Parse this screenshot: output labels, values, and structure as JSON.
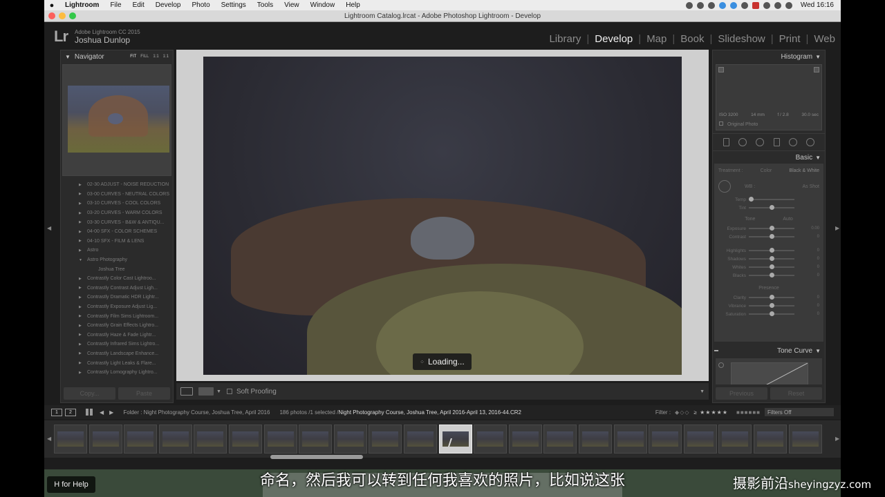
{
  "menubar": {
    "app": "Lightroom",
    "items": [
      "File",
      "Edit",
      "Develop",
      "Photo",
      "Settings",
      "Tools",
      "View",
      "Window",
      "Help"
    ],
    "clock": "Wed 16:16"
  },
  "window": {
    "title": "Lightroom Catalog.lrcat - Adobe Photoshop Lightroom - Develop"
  },
  "identity": {
    "logo": "Lr",
    "product": "Adobe Lightroom CC 2015",
    "user": "Joshua Dunlop"
  },
  "modules": [
    "Library",
    "Develop",
    "Map",
    "Book",
    "Slideshow",
    "Print",
    "Web"
  ],
  "active_module": "Develop",
  "navigator": {
    "title": "Navigator",
    "zoom_options": [
      "FIT",
      "FILL",
      "1:1",
      "1:1"
    ]
  },
  "presets": [
    {
      "label": "02-30 ADJUST - NOISE REDUCTION",
      "type": "folder"
    },
    {
      "label": "03-00 CURVES - NEUTRAL COLORS",
      "type": "folder"
    },
    {
      "label": "03-10 CURVES - COOL COLORS",
      "type": "folder"
    },
    {
      "label": "03-20 CURVES - WARM COLORS",
      "type": "folder"
    },
    {
      "label": "03-30 CURVES - B&W & ANTIQU...",
      "type": "folder"
    },
    {
      "label": "04-00 SFX - COLOR SCHEMES",
      "type": "folder"
    },
    {
      "label": "04-10 SFX - FILM & LENS",
      "type": "folder"
    },
    {
      "label": "Astro",
      "type": "folder"
    },
    {
      "label": "Astro Photography",
      "type": "open"
    },
    {
      "label": "Joshua Tree",
      "type": "child"
    },
    {
      "label": "Contrastly Color Cast Lightroo...",
      "type": "folder"
    },
    {
      "label": "Contrastly Contrast Adjust Ligh...",
      "type": "folder"
    },
    {
      "label": "Contrastly Dramatic HDR Lightr...",
      "type": "folder"
    },
    {
      "label": "Contrastly Exposure Adjust Lig...",
      "type": "folder"
    },
    {
      "label": "Contrastly Film Sims Lightroom...",
      "type": "folder"
    },
    {
      "label": "Contrastly Grain Effects Lightro...",
      "type": "folder"
    },
    {
      "label": "Contrastly Haze & Fade Lightr...",
      "type": "folder"
    },
    {
      "label": "Contrastly Infrared Sims Lightro...",
      "type": "folder"
    },
    {
      "label": "Contrastly Landscape Enhance...",
      "type": "folder"
    },
    {
      "label": "Contrastly Light Leaks & Flare...",
      "type": "folder"
    },
    {
      "label": "Contrastly Lomography Lightro...",
      "type": "folder"
    }
  ],
  "left_buttons": {
    "copy": "Copy...",
    "paste": "Paste"
  },
  "loading": "Loading...",
  "toolbar": {
    "soft_proofing": "Soft Proofing"
  },
  "histogram": {
    "title": "Histogram",
    "iso": "ISO 3200",
    "focal": "14 mm",
    "aperture": "f / 2.8",
    "shutter": "30.0 sec",
    "original_photo": "Original Photo"
  },
  "basic": {
    "title": "Basic",
    "treatment": "Treatment :",
    "color": "Color",
    "bw": "Black & White",
    "wb": "WB :",
    "wb_value": "As Shot",
    "temp": "Temp",
    "tint": "Tint",
    "tone": "Tone",
    "auto": "Auto",
    "exposure": "Exposure",
    "contrast": "Contrast",
    "highlights": "Highlights",
    "shadows": "Shadows",
    "whites": "Whites",
    "blacks": "Blacks",
    "presence": "Presence",
    "clarity": "Clarity",
    "vibrance": "Vibrance",
    "saturation": "Saturation",
    "exposure_val": "0.00",
    "zero": "0"
  },
  "tone_curve": {
    "title": "Tone Curve"
  },
  "right_buttons": {
    "previous": "Previous",
    "reset": "Reset"
  },
  "filmstrip_bar": {
    "view1": "1",
    "view2": "2",
    "folder": "Folder : Night Photography Course, Joshua Tree, April 2016",
    "count": "186 photos /1 selected /",
    "file": "Night Photography Course, Joshua Tree, April 2016-April 13, 2016-44.CR2",
    "filter": "Filter :",
    "filters_off": "Filters Off"
  },
  "help": "H for Help",
  "subtitle": "命名，然后我可以转到任何我喜欢的照片，比如说这张",
  "watermark": {
    "cn": "摄影前沿",
    "domain": "sheyingzyz.com"
  }
}
